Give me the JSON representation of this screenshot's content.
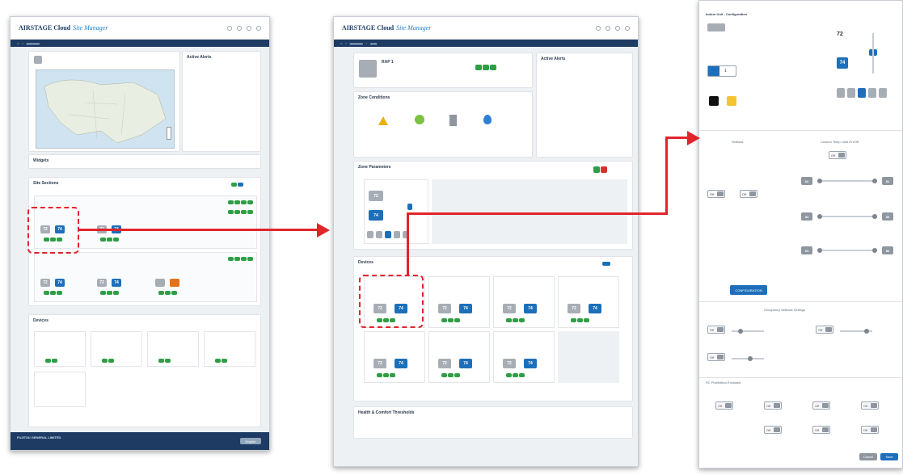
{
  "app": {
    "title": "AIRSTAGE",
    "subtitle": "Cloud",
    "mode": "Site Manager"
  },
  "left": {
    "cards": {
      "alerts": "Active Alerts",
      "widgets": "Widgets",
      "sitesections": "Site Sections",
      "devices": "Devices"
    },
    "temps": [
      "72",
      "74",
      "72",
      "74",
      "72",
      "74",
      "72",
      "74"
    ],
    "footer_company": "FUJITSU GENERAL LIMITED",
    "footer_btn": "English"
  },
  "middle": {
    "zone_name": "RAP 1",
    "cards": {
      "alerts": "Active Alerts",
      "conditions": "Zone Conditions",
      "parameters": "Zone Parameters",
      "devices": "Devices",
      "health": "Health & Comfort Thresholds"
    },
    "param_temps": [
      "72",
      "74"
    ],
    "device_temps": [
      "72",
      "74",
      "72",
      "74",
      "72",
      "74",
      "72",
      "74",
      "72",
      "74",
      "72",
      "74",
      "72",
      "74"
    ]
  },
  "right": {
    "title": "Indoor Unit - Configuration",
    "setpoint_cool": "72",
    "setpoint_heat": "74",
    "fan_value": "1",
    "buttons": {
      "configure": "CONFIGURATION",
      "cancel": "Cancel",
      "save": "Save"
    },
    "sections": {
      "setback": "Setback",
      "occupancy": "Occupancy Setback Settings",
      "prohibition": "RC Prohibition Enclosed",
      "upper_lower": "Custom Temp Limit On/Off"
    },
    "toggle_off": "Off",
    "limits": [
      "64",
      "81",
      "54",
      "80",
      "64",
      "80"
    ]
  }
}
